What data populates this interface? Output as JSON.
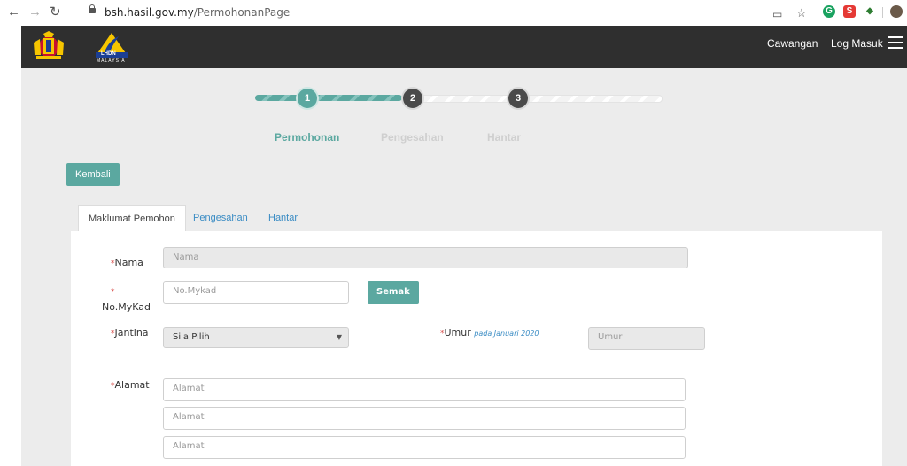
{
  "browser": {
    "url_host": "bsh.hasil.gov.my",
    "url_path": "/PermohonanPage"
  },
  "header": {
    "logo_text": "LHDN",
    "logo_subtext": "MALAYSIA",
    "link_branch": "Cawangan",
    "link_login": "Log Masuk"
  },
  "stepper": {
    "steps": [
      {
        "number": "1",
        "label": "Permohonan",
        "state": "active"
      },
      {
        "number": "2",
        "label": "Pengesahan",
        "state": "inactive"
      },
      {
        "number": "3",
        "label": "Hantar",
        "state": "inactive"
      }
    ]
  },
  "back_button": "Kembali",
  "tabs": [
    {
      "label": "Maklumat Pemohon",
      "active": true
    },
    {
      "label": "Pengesahan",
      "active": false
    },
    {
      "label": "Hantar",
      "active": false
    }
  ],
  "form": {
    "required_mark": "*",
    "nama_label": "Nama",
    "nama_placeholder": "Nama",
    "mykad_label": "No.MyKad",
    "mykad_placeholder": "No.Mykad",
    "semak_button": "Semak",
    "jantina_label": "Jantina",
    "jantina_selected": "Sila Pilih",
    "umur_label": "Umur",
    "umur_note": "pada Januari 2020",
    "umur_placeholder": "Umur",
    "alamat_label": "Alamat",
    "alamat_placeholder_1": "Alamat",
    "alamat_placeholder_2": "Alamat",
    "alamat_placeholder_3": "Alamat"
  },
  "colors": {
    "accent": "#5ba8a0",
    "header_bg": "#2f2f2f",
    "link": "#3a8cc4",
    "required": "#d9534f"
  }
}
